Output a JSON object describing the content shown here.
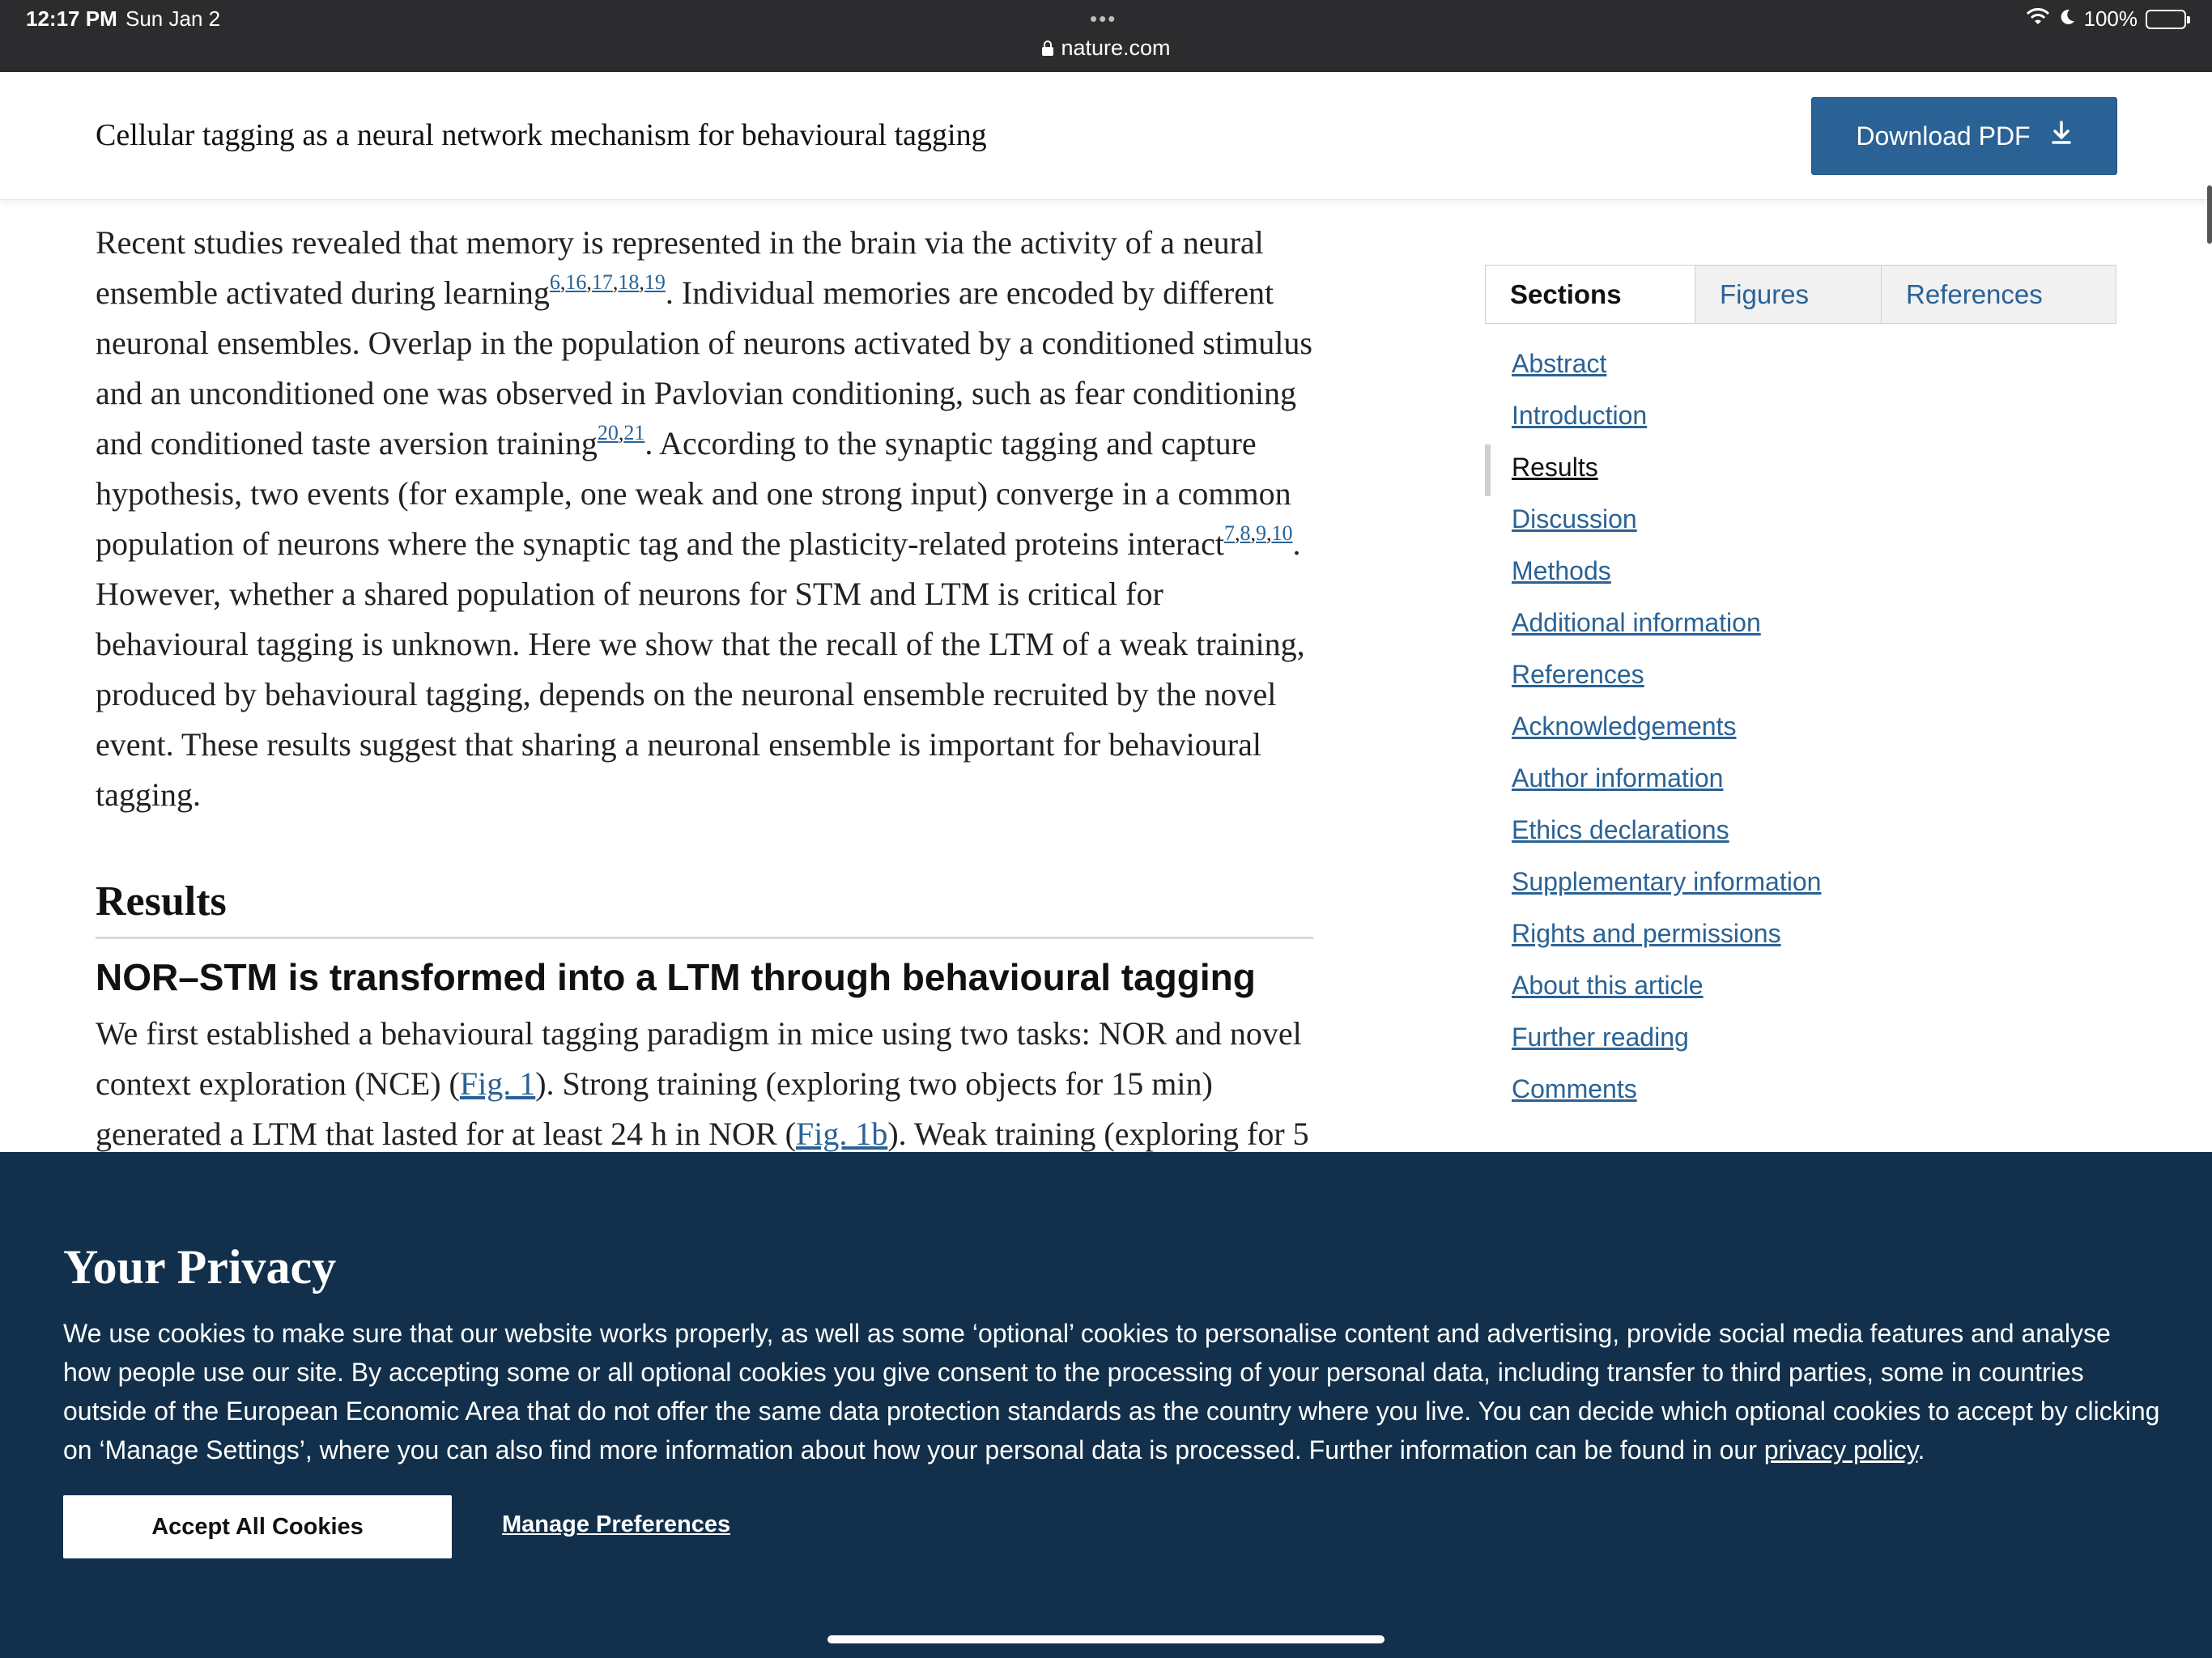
{
  "status_bar": {
    "time": "12:17 PM",
    "date": "Sun Jan 2",
    "url": "nature.com",
    "battery": "100%"
  },
  "header": {
    "article_title": "Cellular tagging as a neural network mechanism for behavioural tagging",
    "download_label": "Download PDF"
  },
  "body": {
    "p1": {
      "s1": "Recent studies revealed that memory is represented in the brain via the activity of a neural ensemble activated during learning",
      "refs1": [
        "6",
        "16",
        "17",
        "18",
        "19"
      ],
      "s2": ". Individual memories are encoded by different neuronal ensembles. Overlap in the population of neurons activated by a conditioned stimulus and an unconditioned one was observed in Pavlovian conditioning, such as fear conditioning and conditioned taste aversion training",
      "refs2": [
        "20",
        "21"
      ],
      "s3": ". According to the synaptic tagging and capture hypothesis, two events (for example, one weak and one strong input) converge in a common population of neurons where the synaptic tag and the plasticity-related proteins interact",
      "refs3": [
        "7",
        "8",
        "9",
        "10"
      ],
      "s4": ". However, whether a shared population of neurons for STM and LTM is critical for behavioural tagging is unknown. Here we show that the recall of the LTM of a weak training, produced by behavioural tagging, depends on the neuronal ensemble recruited by the novel event. These results suggest that sharing a neuronal ensemble is important for behavioural tagging."
    },
    "results_heading": "Results",
    "subheading": "NOR–STM is transformed into a LTM through behavioural tagging",
    "p2": {
      "s1": "We first established a behavioural tagging paradigm in mice using two tasks: NOR and novel context exploration (NCE) (",
      "fig1": "Fig. 1",
      "s2": "). Strong training (exploring two objects for 15 min) generated a LTM that lasted for at least 24 h in NOR (",
      "fig1b": "Fig. 1b",
      "s3": "). Weak training (exploring for 5"
    }
  },
  "sidebar": {
    "tabs": [
      "Sections",
      "Figures",
      "References"
    ],
    "items": [
      "Abstract",
      "Introduction",
      "Results",
      "Discussion",
      "Methods",
      "Additional information",
      "References",
      "Acknowledgements",
      "Author information",
      "Ethics declarations",
      "Supplementary information",
      "Rights and permissions",
      "About this article",
      "Further reading",
      "Comments"
    ]
  },
  "privacy": {
    "title": "Your Privacy",
    "text": "We use cookies to make sure that our website works properly, as well as some ‘optional’ cookies to personalise content and advertising, provide social media features and analyse how people use our site. By accepting some or all optional cookies you give consent to the processing of your personal data, including transfer to third parties, some in countries outside of the European Economic Area that do not offer the same data protection standards as the country where you live. You can decide which optional cookies to accept by clicking on ‘Manage Settings’, where you can also find more information about how your personal data is processed. Further information can be found in our ",
    "link": "privacy policy",
    "end": ".",
    "accept_label": "Accept All Cookies",
    "manage_label": "Manage Preferences"
  },
  "colors": {
    "link": "#2a6296",
    "download_button": "#2a6296",
    "banner": "#12304b",
    "status_bar": "#2c2c2e"
  }
}
